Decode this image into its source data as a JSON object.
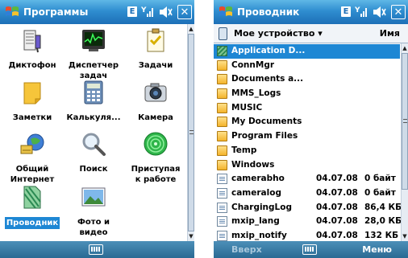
{
  "left": {
    "title": "Программы",
    "status": {
      "e_indicator": "E",
      "signal": "Y",
      "volume_icon": "speaker-icon",
      "close_icon": "close-icon"
    },
    "programs": [
      {
        "label": "Диктофон",
        "icon": "voice-recorder-icon"
      },
      {
        "label": "Диспетчер\nзадач",
        "icon": "task-manager-icon"
      },
      {
        "label": "Задачи",
        "icon": "tasks-icon"
      },
      {
        "label": "Заметки",
        "icon": "notes-icon"
      },
      {
        "label": "Калькуля...",
        "icon": "calculator-icon"
      },
      {
        "label": "Камера",
        "icon": "camera-icon"
      },
      {
        "label": "Общий\nИнтернет",
        "icon": "internet-sharing-icon"
      },
      {
        "label": "Поиск",
        "icon": "search-icon"
      },
      {
        "label": "Приступая\nк работе",
        "icon": "getting-started-icon"
      },
      {
        "label": "Проводник",
        "icon": "file-explorer-icon",
        "selected": true
      },
      {
        "label": "Фото и\nвидео",
        "icon": "pictures-videos-icon"
      }
    ],
    "softkeys": {
      "sip_icon": "keyboard-icon"
    }
  },
  "right": {
    "title": "Проводник",
    "status": {
      "e_indicator": "E",
      "signal": "Y",
      "volume_icon": "speaker-icon",
      "close_icon": "close-icon"
    },
    "location": "Мое устройство",
    "sort": "Имя",
    "files": [
      {
        "name": "Application D...",
        "type": "app-folder",
        "date": "",
        "size": "",
        "selected": true
      },
      {
        "name": "ConnMgr",
        "type": "folder",
        "date": "",
        "size": ""
      },
      {
        "name": "Documents a...",
        "type": "folder",
        "date": "",
        "size": ""
      },
      {
        "name": "MMS_Logs",
        "type": "folder",
        "date": "",
        "size": ""
      },
      {
        "name": "MUSIC",
        "type": "folder",
        "date": "",
        "size": ""
      },
      {
        "name": "My Documents",
        "type": "folder",
        "date": "",
        "size": ""
      },
      {
        "name": "Program Files",
        "type": "folder",
        "date": "",
        "size": ""
      },
      {
        "name": "Temp",
        "type": "folder",
        "date": "",
        "size": ""
      },
      {
        "name": "Windows",
        "type": "folder",
        "date": "",
        "size": ""
      },
      {
        "name": "camerabho",
        "type": "file",
        "date": "04.07.08",
        "size": "0 байт"
      },
      {
        "name": "cameralog",
        "type": "file",
        "date": "04.07.08",
        "size": "0 байт"
      },
      {
        "name": "ChargingLog",
        "type": "file",
        "date": "04.07.08",
        "size": "86,4 КБ"
      },
      {
        "name": "mxip_lang",
        "type": "file",
        "date": "04.07.08",
        "size": "28,0 КБ"
      },
      {
        "name": "mxip_notify",
        "type": "file",
        "date": "04.07.08",
        "size": "132 КБ"
      }
    ],
    "softkeys": {
      "left": "Вверх",
      "right": "Меню",
      "sip_icon": "keyboard-icon"
    }
  }
}
